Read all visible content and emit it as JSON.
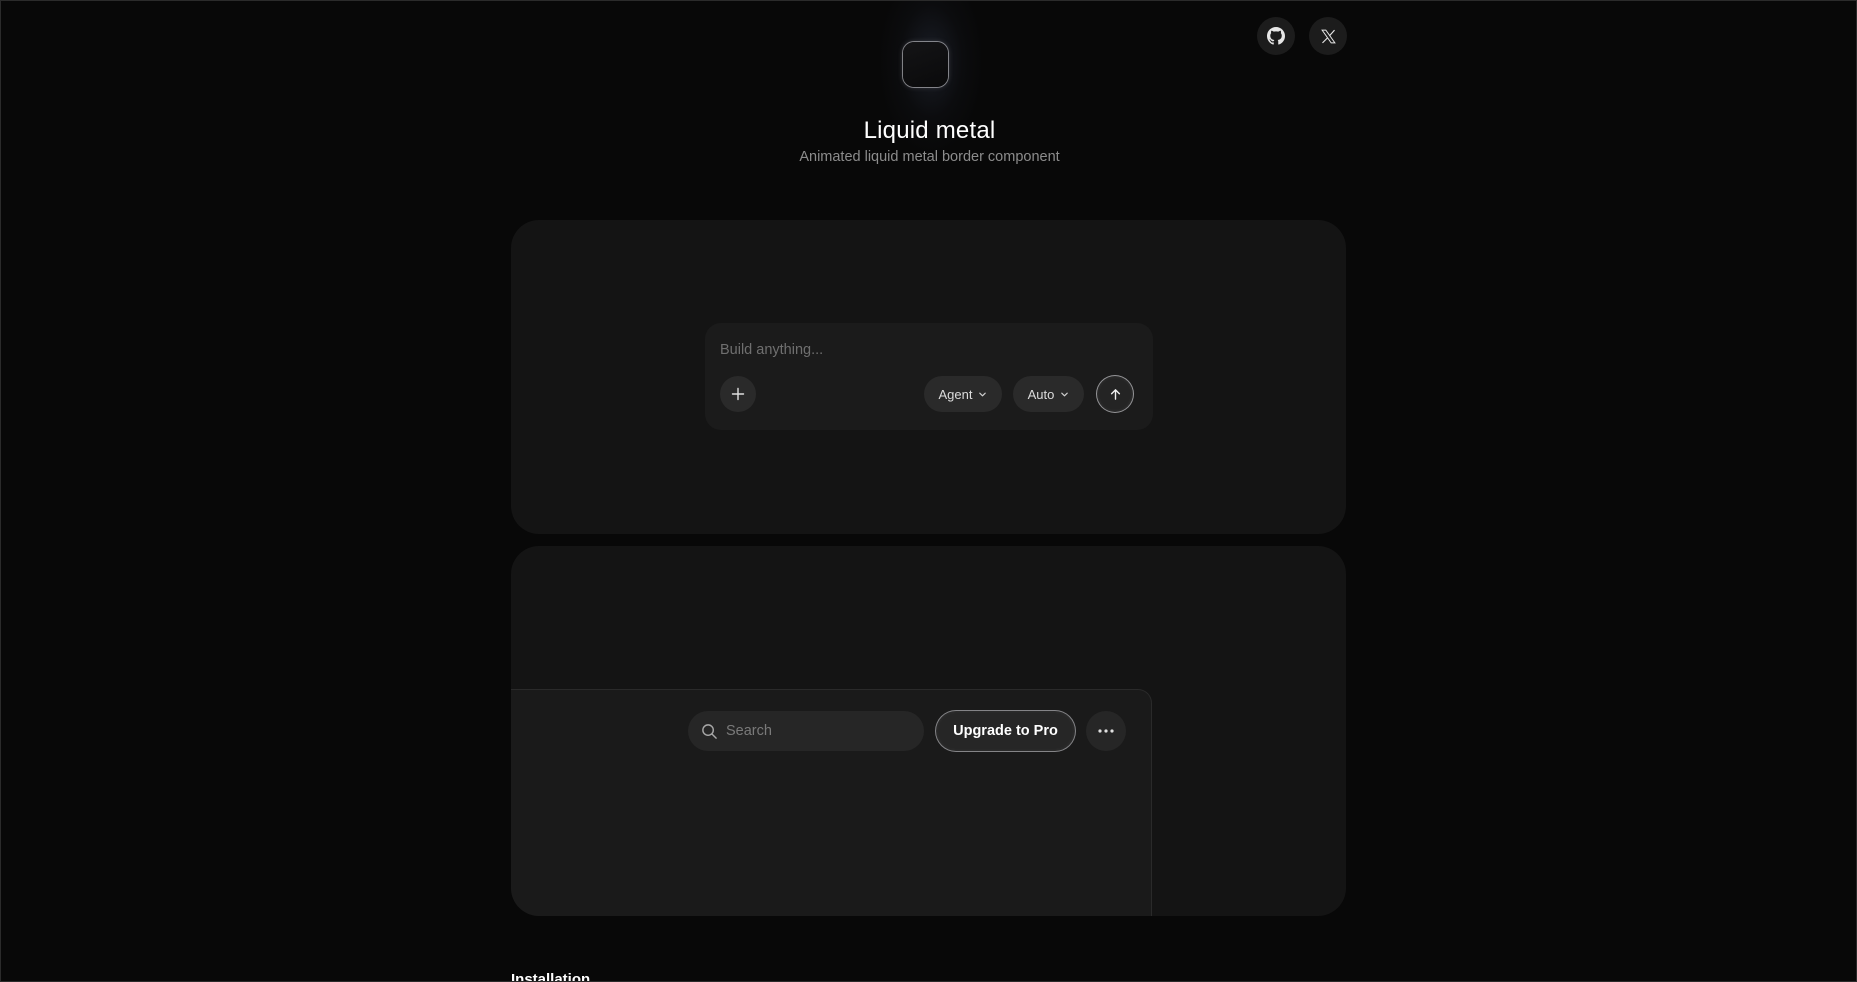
{
  "header": {
    "title": "Liquid metal",
    "subtitle": "Animated liquid metal border component",
    "social": [
      {
        "name": "github-icon",
        "label": "GitHub"
      },
      {
        "name": "x-icon",
        "label": "X"
      }
    ]
  },
  "demo_composer": {
    "placeholder": "Build anything...",
    "agent_label": "Agent",
    "model_label": "Auto"
  },
  "demo_toolbar": {
    "search_placeholder": "Search",
    "upgrade_label": "Upgrade to Pro"
  },
  "sections": {
    "installation": "Installation"
  },
  "colors": {
    "background": "#080808",
    "card": "#141414",
    "control": "#2a2a2a",
    "metal_border": "#d8d8dc"
  }
}
